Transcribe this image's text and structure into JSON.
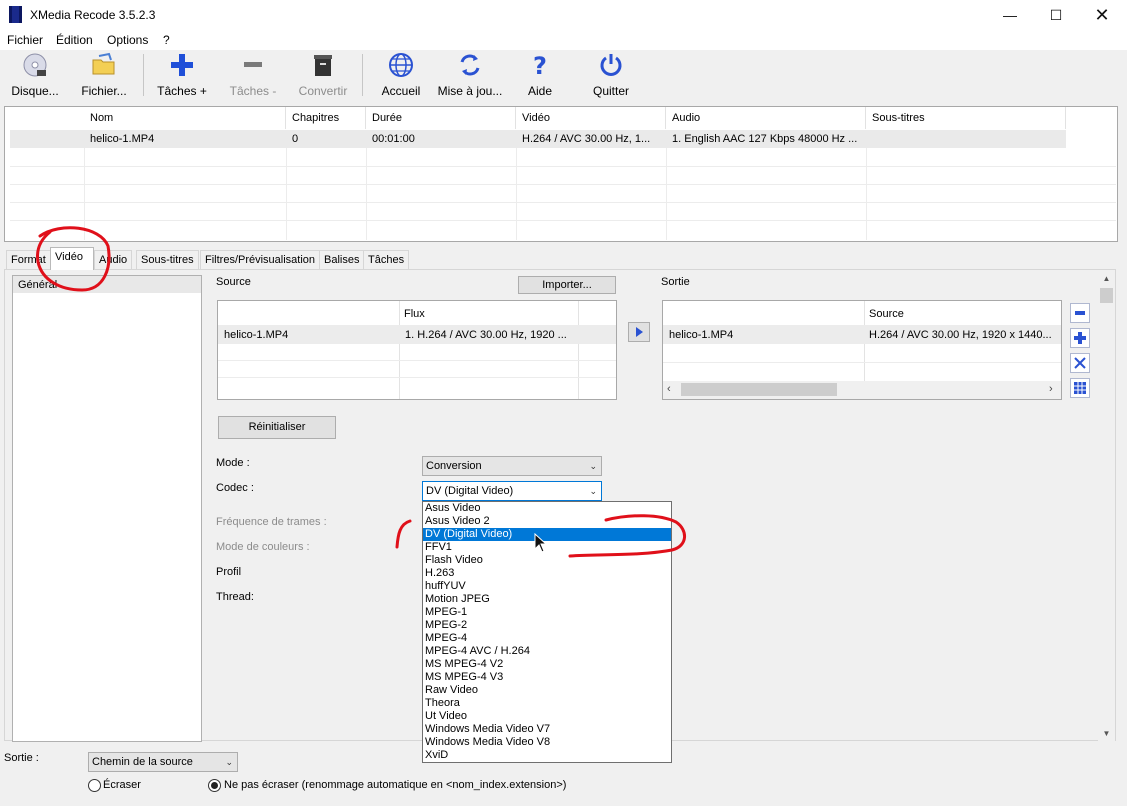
{
  "window": {
    "title": "XMedia Recode 3.5.2.3"
  },
  "menu": [
    "Fichier",
    "Édition",
    "Options",
    "?"
  ],
  "toolbar": {
    "disc": "Disque...",
    "file": "Fichier...",
    "add_task": "Tâches +",
    "remove_task": "Tâches -",
    "convert": "Convertir",
    "home": "Accueil",
    "update": "Mise à jou...",
    "help": "Aide",
    "quit": "Quitter"
  },
  "jobs": {
    "headers": [
      "Nom",
      "Chapitres",
      "Durée",
      "Vidéo",
      "Audio",
      "Sous-titres"
    ],
    "rows": [
      {
        "name": "helico-1.MP4",
        "chapters": "0",
        "duration": "00:01:00",
        "video": "H.264 / AVC  30.00 Hz, 1...",
        "audio": "1. English AAC  127 Kbps 48000 Hz ...",
        "subs": ""
      }
    ]
  },
  "tabs": [
    "Format",
    "Vidéo",
    "Audio",
    "Sous-titres",
    "Filtres/Prévisualisation",
    "Balises",
    "Tâches"
  ],
  "side": {
    "item": "Général"
  },
  "source": {
    "label": "Source",
    "import": "Importer...",
    "col_flux": "Flux",
    "row_name": "helico-1.MP4",
    "row_flux": "1. H.264 / AVC  30.00 Hz, 1920 ..."
  },
  "output": {
    "label": "Sortie",
    "col_source": "Source",
    "row_name": "helico-1.MP4",
    "row_source": "H.264 / AVC  30.00 Hz, 1920 x 1440..."
  },
  "reset": "Réinitialiser",
  "fields": {
    "mode_label": "Mode :",
    "mode_value": "Conversion",
    "codec_label": "Codec :",
    "codec_value": "DV (Digital Video)",
    "framerate_label": "Fréquence de trames :",
    "colormode_label": "Mode de couleurs :",
    "profile_label": "Profil",
    "thread_label": "Thread:"
  },
  "codec_options": [
    "Asus Video",
    "Asus Video 2",
    "DV (Digital Video)",
    "FFV1",
    "Flash Video",
    "H.263",
    "huffYUV",
    "Motion JPEG",
    "MPEG-1",
    "MPEG-2",
    "MPEG-4",
    "MPEG-4 AVC / H.264",
    "MS MPEG-4 V2",
    "MS MPEG-4 V3",
    "Raw Video",
    "Theora",
    "Ut Video",
    "Windows Media Video V7",
    "Windows Media Video V8",
    "XviD"
  ],
  "codec_selected_index": 2,
  "bottom": {
    "output_label": "Sortie :",
    "output_value": "Chemin de la source",
    "overwrite": "Écraser",
    "no_overwrite": "Ne pas écraser (renommage automatique en <nom_index.extension>)"
  },
  "colors": {
    "accent": "#0078d7",
    "annotation": "#e0101a",
    "toolbar_blue": "#1f4fd8"
  }
}
